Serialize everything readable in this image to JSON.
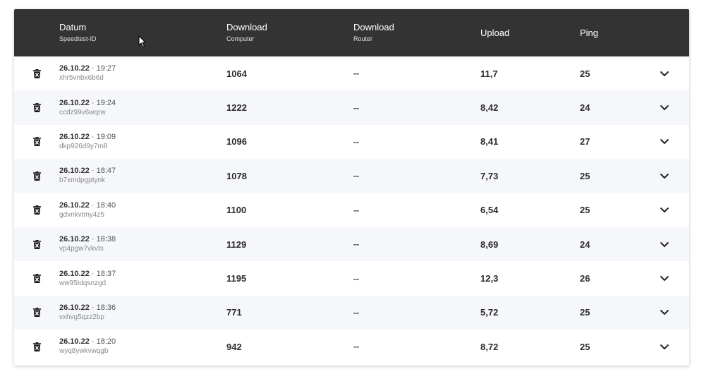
{
  "header": {
    "date_label": "Datum",
    "date_sub": "Speedtest-ID",
    "dl_pc_label": "Download",
    "dl_pc_sub": "Computer",
    "dl_router_label": "Download",
    "dl_router_sub": "Router",
    "upload_label": "Upload",
    "ping_label": "Ping"
  },
  "icons": {
    "delete": "trash-icon",
    "expand": "chevron-down-icon"
  },
  "colors": {
    "header_bg": "#333333",
    "row_alt_bg": "#f5f7fa"
  },
  "rows": [
    {
      "date": "26.10.22",
      "time": "· 19:27",
      "id": "xhr5vnbx6b6d",
      "dl_pc": "1064",
      "dl_router": "--",
      "upload": "11,7",
      "ping": "25"
    },
    {
      "date": "26.10.22",
      "time": "· 19:24",
      "id": "ccdz99v6wqrw",
      "dl_pc": "1222",
      "dl_router": "--",
      "upload": "8,42",
      "ping": "24"
    },
    {
      "date": "26.10.22",
      "time": "· 19:09",
      "id": "dkp926d9y7m8",
      "dl_pc": "1096",
      "dl_router": "--",
      "upload": "8,41",
      "ping": "27"
    },
    {
      "date": "26.10.22",
      "time": "· 18:47",
      "id": "b7xmdpgptynk",
      "dl_pc": "1078",
      "dl_router": "--",
      "upload": "7,73",
      "ping": "25"
    },
    {
      "date": "26.10.22",
      "time": "· 18:40",
      "id": "gdvnkvtmy4z5",
      "dl_pc": "1100",
      "dl_router": "--",
      "upload": "6,54",
      "ping": "25"
    },
    {
      "date": "26.10.22",
      "time": "· 18:38",
      "id": "vp4pgw7vkvts",
      "dl_pc": "1129",
      "dl_router": "--",
      "upload": "8,69",
      "ping": "24"
    },
    {
      "date": "26.10.22",
      "time": "· 18:37",
      "id": "ww95tdqsnzgd",
      "dl_pc": "1195",
      "dl_router": "--",
      "upload": "12,3",
      "ping": "26"
    },
    {
      "date": "26.10.22",
      "time": "· 18:36",
      "id": "vxhvg5qzz2bp",
      "dl_pc": "771",
      "dl_router": "--",
      "upload": "5,72",
      "ping": "25"
    },
    {
      "date": "26.10.22",
      "time": "· 18:20",
      "id": "wyq8ywkvwqgb",
      "dl_pc": "942",
      "dl_router": "--",
      "upload": "8,72",
      "ping": "25"
    }
  ]
}
